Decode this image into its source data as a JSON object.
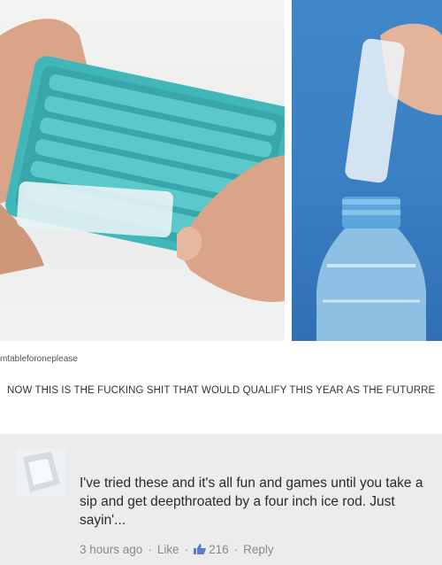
{
  "post": {
    "username": "mtableforoneplease",
    "text": "NOW THIS IS THE FUCKING SHIT THAT WOULD QUALIFY THIS YEAR AS THE FUTURRE"
  },
  "comment": {
    "text": "I've tried these and it's all fun and games until you take a sip and get deepthroated by a four inch ice rod. Just sayin'...",
    "time": "3 hours ago",
    "like_label": "Like",
    "like_count": "216",
    "reply_label": "Reply",
    "separator": "·"
  },
  "colors": {
    "tray": "#3fb3b6",
    "water": "#3a7fc2",
    "comment_bg": "#ececec"
  }
}
